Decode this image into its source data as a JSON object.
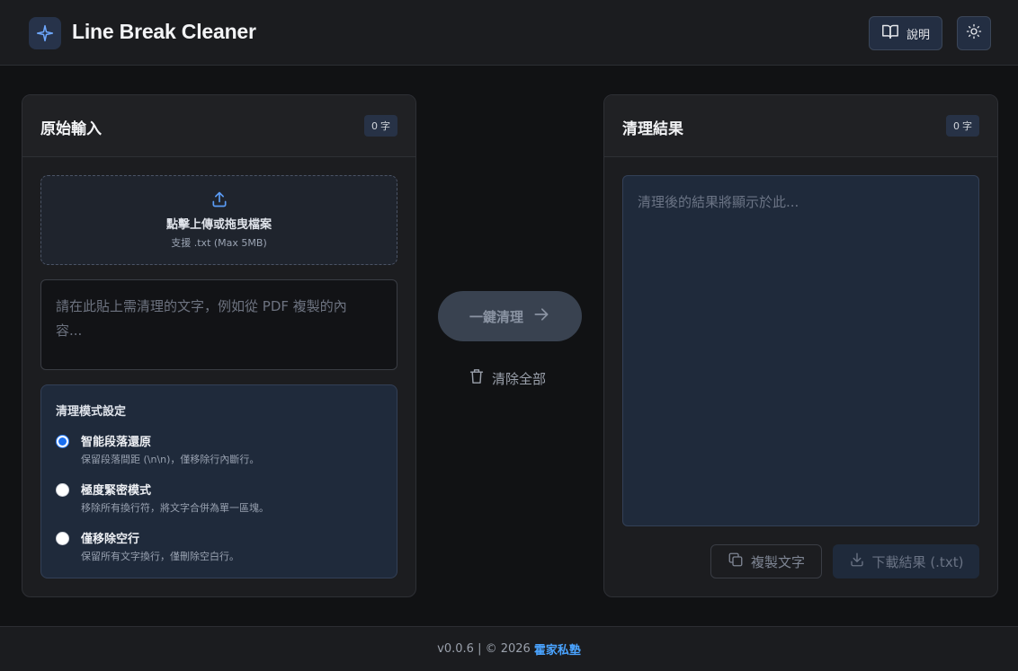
{
  "header": {
    "title": "Line Break Cleaner",
    "help_label": "說明",
    "logo_icon": "sparkle-icon",
    "theme_icon": "sun-icon"
  },
  "input_panel": {
    "title": "原始輸入",
    "count": "0",
    "count_unit": "字",
    "upload": {
      "title": "點擊上傳或拖曳檔案",
      "subtitle": "支援 .txt (Max 5MB)"
    },
    "placeholder_line1": "請在此貼上需清理的文字，例如從 PDF 複製的內",
    "placeholder_line2": "容..."
  },
  "modes": {
    "title": "清理模式設定",
    "options": [
      {
        "label": "智能段落還原",
        "desc": "保留段落間距 (\\n\\n)，僅移除行內斷行。",
        "checked": true
      },
      {
        "label": "極度緊密模式",
        "desc": "移除所有換行符，將文字合併為單一區塊。",
        "checked": false
      },
      {
        "label": "僅移除空行",
        "desc": "保留所有文字換行，僅刪除空白行。",
        "checked": false
      }
    ]
  },
  "actions": {
    "clean_label": "一鍵清理",
    "clear_label": "清除全部"
  },
  "output_panel": {
    "title": "清理結果",
    "count": "0",
    "count_unit": "字",
    "placeholder": "清理後的結果將顯示於此...",
    "copy_label": "複製文字",
    "download_label": "下載結果 (.txt)"
  },
  "footer": {
    "version_text": "v0.0.6 | © 2026",
    "link_text": "霍家私塾"
  },
  "colors": {
    "accent": "#2d7ff9",
    "background": "#111214",
    "panel": "#1c1d20",
    "link": "#4aa3ff"
  }
}
